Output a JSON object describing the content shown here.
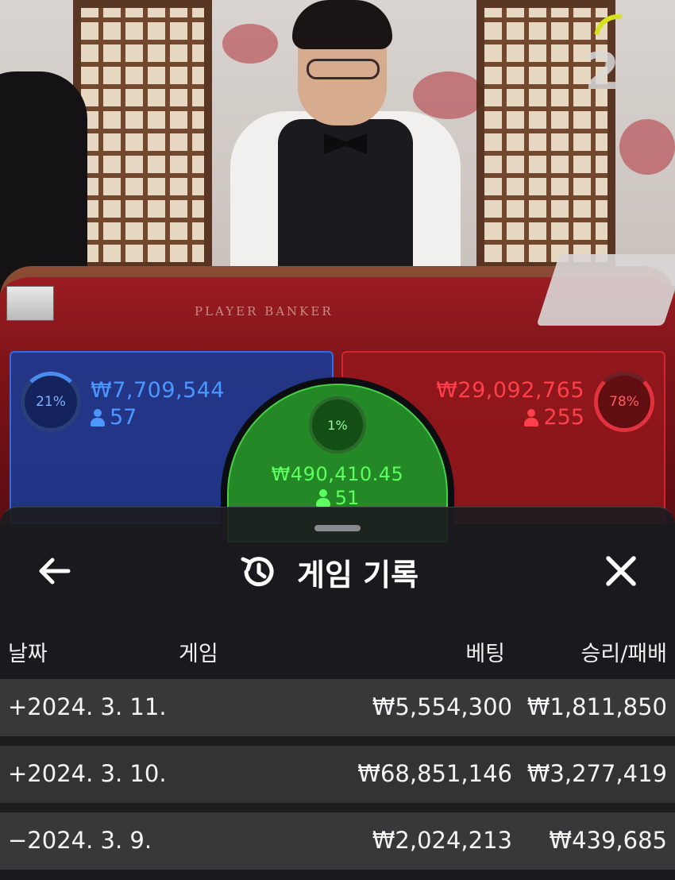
{
  "video": {
    "table_print": "PLAYER     BANKER",
    "countdown": "2"
  },
  "bets": {
    "player": {
      "percent": "21%",
      "amount": "₩7,709,544",
      "players": "57"
    },
    "tie": {
      "percent": "1%",
      "amount": "₩490,410.45",
      "players": "51"
    },
    "banker": {
      "percent": "78%",
      "amount": "₩29,092,765",
      "players": "255"
    },
    "colors": {
      "player": "#2f6be6",
      "tie": "#47d04a",
      "banker": "#d0262e"
    }
  },
  "sheet": {
    "title": "게임 기록",
    "back_icon": "arrow-left-icon",
    "history_icon": "history-icon",
    "close_icon": "close-icon",
    "columns": {
      "date": "날짜",
      "game": "게임",
      "bet": "베팅",
      "result": "승리/패배"
    },
    "rows": [
      {
        "date": "+2024. 3. 11.",
        "bet": "₩5,554,300",
        "result": "₩1,811,850"
      },
      {
        "date": "+2024. 3. 10.",
        "bet": "₩68,851,146",
        "result": "₩3,277,419"
      },
      {
        "date": "−2024. 3. 9.",
        "bet": "₩2,024,213",
        "result": "₩439,685"
      }
    ]
  }
}
